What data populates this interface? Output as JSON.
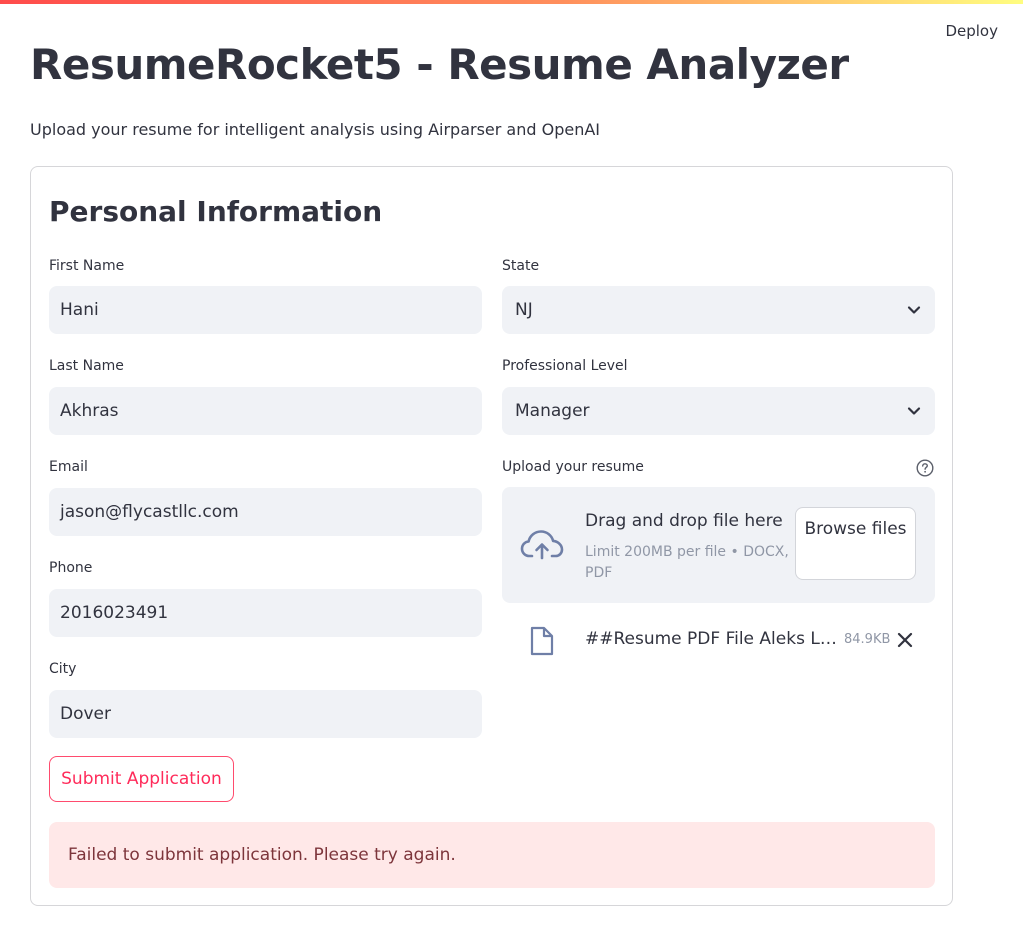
{
  "header": {
    "deploy_label": "Deploy"
  },
  "page": {
    "title": "ResumeRocket5 - Resume Analyzer",
    "subtitle": "Upload your resume for intelligent analysis using Airparser and OpenAI"
  },
  "form": {
    "section_title": "Personal Information",
    "first_name": {
      "label": "First Name",
      "value": "Hani"
    },
    "last_name": {
      "label": "Last Name",
      "value": "Akhras"
    },
    "email": {
      "label": "Email",
      "value": "jason@flycastllc.com"
    },
    "phone": {
      "label": "Phone",
      "value": "2016023491"
    },
    "city": {
      "label": "City",
      "value": "Dover"
    },
    "state": {
      "label": "State",
      "selected": "NJ"
    },
    "professional_level": {
      "label": "Professional Level",
      "selected": "Manager"
    },
    "upload": {
      "label": "Upload your resume",
      "dropzone_title": "Drag and drop file here",
      "limit_text": "Limit 200MB per file • DOCX, PDF",
      "browse_label": "Browse files"
    },
    "uploaded_file": {
      "name": "##Resume PDF File Aleks Ljul...",
      "size": "84.9KB"
    },
    "submit_label": "Submit Application",
    "error_message": "Failed to submit application. Please try again."
  },
  "icons": {
    "help": "help-circle-icon",
    "chevron": "chevron-down-icon",
    "upload": "cloud-upload-icon",
    "file": "file-icon",
    "remove": "close-icon"
  },
  "colors": {
    "accent": "#ff4b4b",
    "input_bg": "#f0f2f6",
    "error_bg": "#ffe8e8",
    "error_text": "#7d353b",
    "submit_text": "#ff2b5a",
    "muted_text": "#9097a6",
    "icon_blue": "#6f7fa7"
  }
}
